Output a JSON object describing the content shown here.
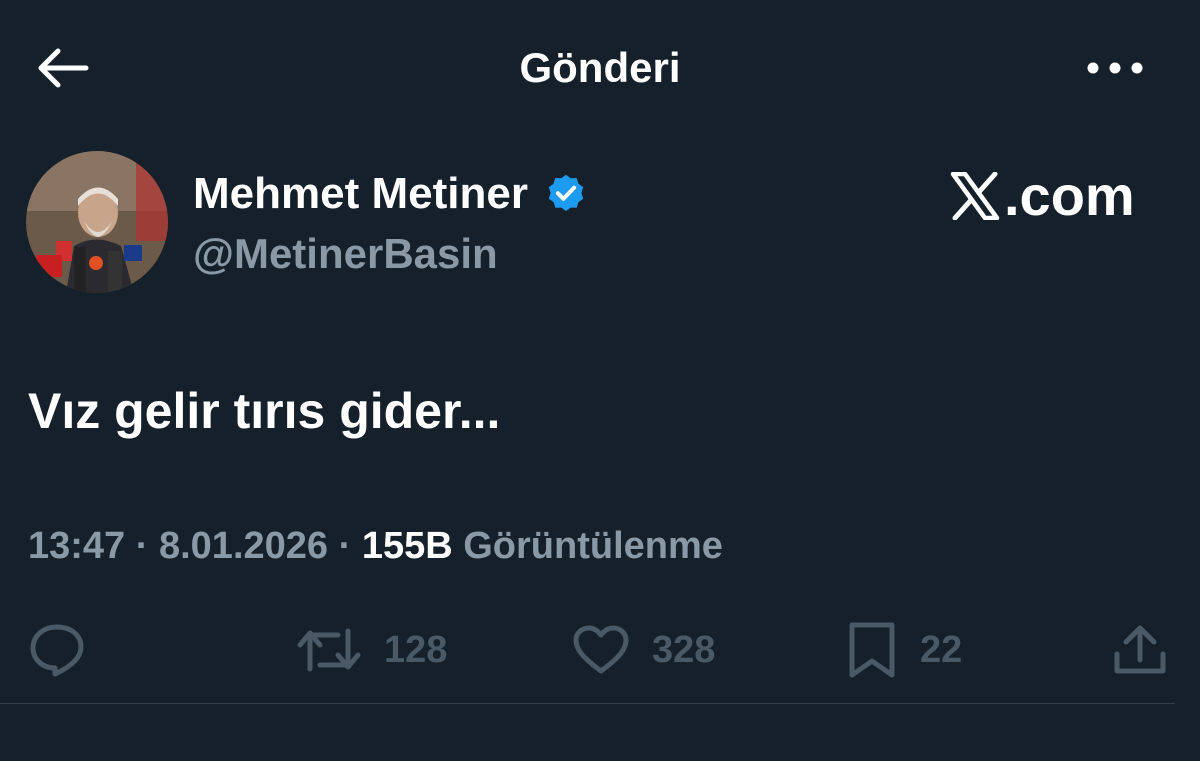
{
  "header": {
    "title": "Gönderi",
    "back_icon": "arrow-left-icon",
    "more_icon": "more-horizontal-icon"
  },
  "author": {
    "name": "Mehmet Metiner",
    "handle": "@MetinerBasin",
    "verified_icon": "verified-badge-icon",
    "verified_color": "#1d9bf0"
  },
  "brand": {
    "logo": "X",
    "suffix": ".com"
  },
  "tweet": {
    "text": "Vız gelir tırıs gider...",
    "time": "13:47",
    "separator": "·",
    "date": "8.01.2026",
    "views_count": "155B",
    "views_label": "Görüntülenme"
  },
  "actions": {
    "reply": {
      "icon": "reply-icon",
      "count": ""
    },
    "retweet": {
      "icon": "retweet-icon",
      "count": "128"
    },
    "like": {
      "icon": "heart-icon",
      "count": "328"
    },
    "bookmark": {
      "icon": "bookmark-icon",
      "count": "22"
    },
    "share": {
      "icon": "share-icon",
      "count": ""
    }
  },
  "colors": {
    "background": "#15202b",
    "text_primary": "#ffffff",
    "text_secondary": "#8b98a5",
    "action_muted": "#4b5966"
  }
}
